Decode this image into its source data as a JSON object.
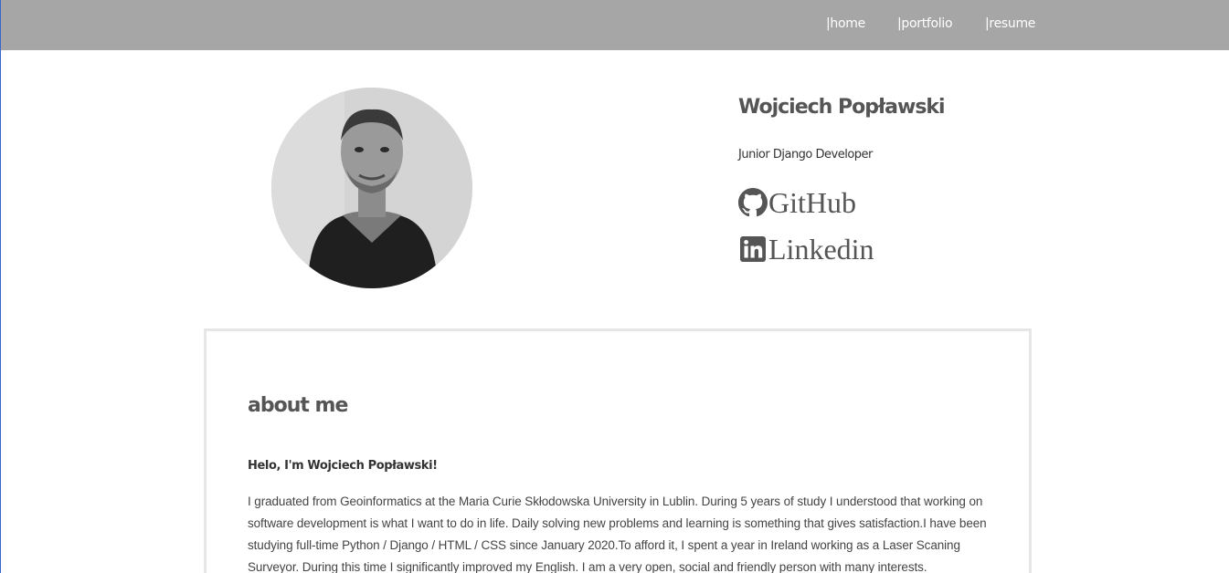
{
  "nav": {
    "items": [
      "|home",
      "|portfolio",
      "|resume"
    ]
  },
  "profile": {
    "name": "Wojciech Popławski",
    "role": "Junior Django Developer",
    "links": {
      "github": {
        "label": "GitHub",
        "icon": "github-icon"
      },
      "linkedin": {
        "label": "Linkedin",
        "icon": "linkedin-icon"
      }
    }
  },
  "about": {
    "title": "about me",
    "greeting": "Helo, I'm Wojciech Popławski!",
    "text": "I graduated from Geoinformatics at the Maria Curie Skłodowska University in Lublin. During 5 years of study I understood that working on software development is what I want to do in life. Daily solving new problems and learning is something that gives satisfaction.I have been studying full-time Python / Django / HTML / CSS since January 2020.To afford it, I spent a year in Ireland working as a Laser Scaning Surveyor. During this time I significantly improved my English. I am a very open, social and friendly person with many interests."
  },
  "colors": {
    "topbar": "#a6a6a6",
    "nav_text": "#ffffff",
    "text_dark": "#555555",
    "card_border": "#e6e6e6",
    "left_rule": "#3b66c9"
  }
}
